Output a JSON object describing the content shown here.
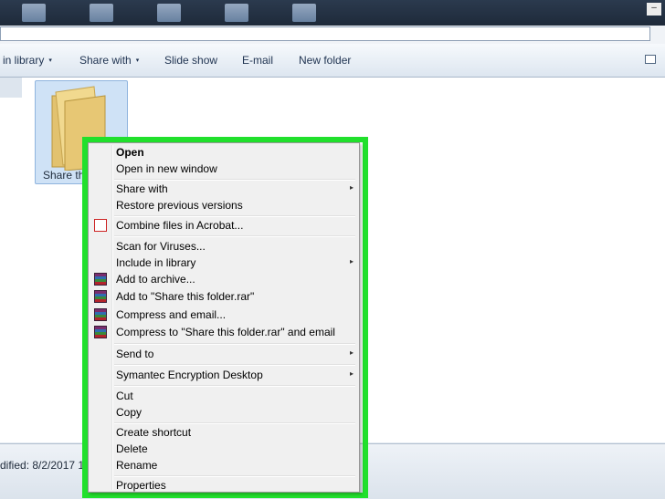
{
  "toolbar": {
    "include_in_library": "in library",
    "share_with": "Share with",
    "slide_show": "Slide show",
    "email": "E-mail",
    "new_folder": "New folder"
  },
  "folder": {
    "label": "Share thi"
  },
  "status_bar": {
    "modified_text": "dified:  8/2/2017 1"
  },
  "context_menu": {
    "items": [
      {
        "label": "Open",
        "bold": true
      },
      {
        "label": "Open in new window"
      },
      {
        "label": "Share with",
        "submenu": true
      },
      {
        "label": "Restore previous versions"
      },
      {
        "label": "Combine files in Acrobat...",
        "icon": "acrobat-icon"
      },
      {
        "label": "Scan for Viruses..."
      },
      {
        "label": "Include in library",
        "submenu": true
      },
      {
        "label": "Add to archive...",
        "icon": "winrar-icon"
      },
      {
        "label": "Add to \"Share this folder.rar\"",
        "icon": "winrar-icon"
      },
      {
        "label": "Compress and email...",
        "icon": "winrar-icon"
      },
      {
        "label": "Compress to \"Share this folder.rar\" and email",
        "icon": "winrar-icon"
      },
      {
        "label": "Send to",
        "submenu": true
      },
      {
        "label": "Symantec Encryption Desktop",
        "submenu": true
      },
      {
        "label": "Cut"
      },
      {
        "label": "Copy"
      },
      {
        "label": "Create shortcut"
      },
      {
        "label": "Delete"
      },
      {
        "label": "Rename"
      },
      {
        "label": "Properties"
      }
    ]
  },
  "colors": {
    "highlight": "#21e02c",
    "menu_background": "#f0f0f0"
  },
  "icons": {
    "folder": "folder-icon",
    "submenu_arrow": "▸",
    "toolbar_dropdown": "▾"
  }
}
